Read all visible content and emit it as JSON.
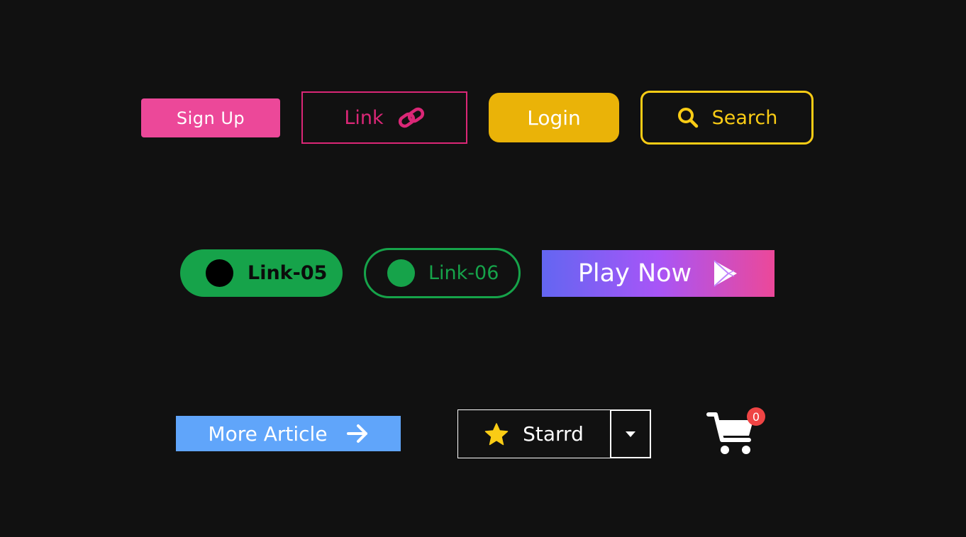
{
  "colors": {
    "background": "#111111",
    "pink": "#ec4899",
    "rose": "#db2777",
    "amber": "#eab308",
    "yellow": "#facc15",
    "green": "#16a34a",
    "gradient_start": "#6366f1",
    "gradient_mid": "#a855f7",
    "gradient_end": "#ec4899",
    "blue": "#60a5fa",
    "star": "#facc15",
    "badge": "#ef4444"
  },
  "row1": {
    "signup_label": "Sign Up",
    "link_label": "Link",
    "link_icon": "link-icon",
    "login_label": "Login",
    "search_label": "Search",
    "search_icon": "search-icon"
  },
  "row2": {
    "link05_label": "Link-05",
    "link06_label": "Link-06",
    "playnow_label": "Play Now",
    "playnow_icon": "play-store-icon"
  },
  "row3": {
    "more_label": "More Article",
    "more_icon": "arrow-right-icon",
    "starrd_label": "Starrd",
    "starrd_icon": "star-icon",
    "dropdown_icon": "caret-down-icon",
    "cart_icon": "shopping-cart-icon",
    "cart_count": "0"
  }
}
